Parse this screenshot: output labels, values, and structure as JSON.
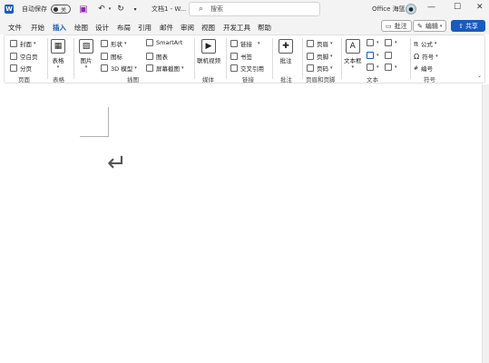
{
  "titlebar": {
    "logo_letter": "W",
    "autosave_label": "自动保存",
    "autosave_state": "关",
    "doc_name": "文档1 - W...",
    "search_placeholder": "搜索",
    "user_name": "Office 海篮",
    "minimize": "—",
    "maximize": "☐",
    "close": "✕"
  },
  "tabs": [
    {
      "label": "文件"
    },
    {
      "label": "开始"
    },
    {
      "label": "插入"
    },
    {
      "label": "绘图"
    },
    {
      "label": "设计"
    },
    {
      "label": "布局"
    },
    {
      "label": "引用"
    },
    {
      "label": "邮件"
    },
    {
      "label": "审阅"
    },
    {
      "label": "视图"
    },
    {
      "label": "开发工具"
    },
    {
      "label": "帮助"
    }
  ],
  "active_tab": "插入",
  "header_buttons": {
    "comment": "批注",
    "edit": "编辑",
    "share": "共享"
  },
  "ribbon": {
    "pages": {
      "cover": "封面",
      "blank": "空白页",
      "break": "分页",
      "group": "页面"
    },
    "tables": {
      "table": "表格",
      "group": "表格"
    },
    "illustrations": {
      "picture": "图片",
      "shapes": "形状",
      "icons": "图标",
      "model3d": "3D 模型",
      "smartart": "SmartArt",
      "chart": "图表",
      "screenshot": "屏幕截图",
      "group": "插图"
    },
    "media": {
      "online_video": "联机视频",
      "group": "媒体"
    },
    "links": {
      "link": "链接",
      "bookmark": "书签",
      "cross_ref": "交叉引用",
      "group": "链接"
    },
    "comments": {
      "comment": "批注",
      "group": "批注"
    },
    "header_footer": {
      "header": "页眉",
      "footer": "页脚",
      "page_number": "页码",
      "group": "页眉和页脚"
    },
    "text": {
      "textbox": "文本框",
      "group": "文本"
    },
    "symbols": {
      "equation": "公式",
      "symbol": "符号",
      "number": "编号",
      "group": "符号"
    }
  },
  "colors": {
    "accent": "#185abd",
    "chrome": "#f3f3f3"
  }
}
